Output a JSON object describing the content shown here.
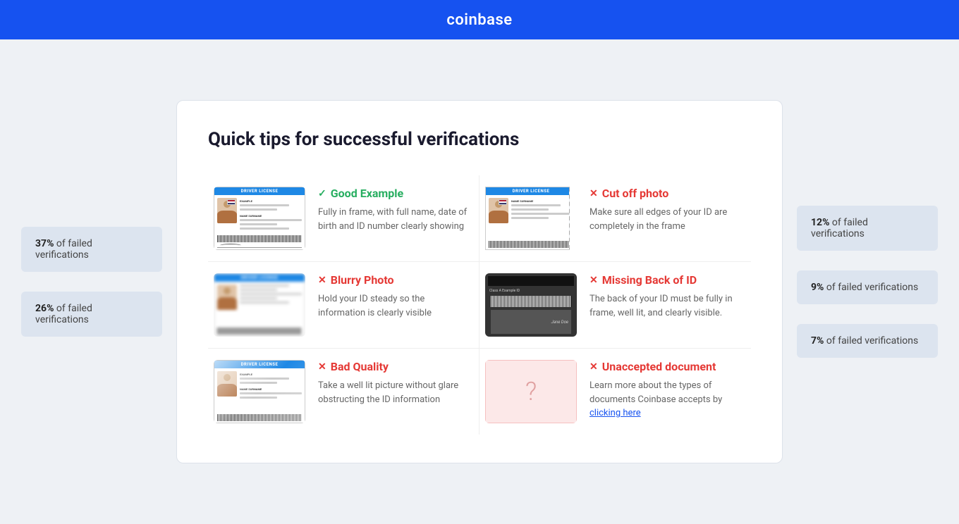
{
  "header": {
    "logo": "coinbase"
  },
  "page": {
    "title": "Quick tips for successful verifications"
  },
  "left_stats": [
    {
      "percent": "37%",
      "label": "of failed verifications"
    },
    {
      "percent": "26%",
      "label": "of failed verifications"
    }
  ],
  "right_stats": [
    {
      "percent": "12%",
      "label": "of failed verifications"
    },
    {
      "percent": "9%",
      "label": "of failed verifications"
    },
    {
      "percent": "7%",
      "label": "of failed verifications"
    }
  ],
  "examples": [
    {
      "id": "good-example",
      "type": "good",
      "icon": "✓",
      "title": "Good Example",
      "description": "Fully in frame, with full name, date of birth and ID number clearly showing"
    },
    {
      "id": "cut-off",
      "type": "bad",
      "icon": "✕",
      "title": "Cut off photo",
      "description": "Make sure all edges of your ID are completely in the frame"
    },
    {
      "id": "blurry",
      "type": "bad",
      "icon": "✕",
      "title": "Blurry Photo",
      "description": "Hold your ID steady so the information is clearly visible"
    },
    {
      "id": "missing-back",
      "type": "bad",
      "icon": "✕",
      "title": "Missing Back of ID",
      "description": "The back of your ID must be fully in frame, well lit, and clearly visible."
    },
    {
      "id": "bad-quality",
      "type": "bad",
      "icon": "✕",
      "title": "Bad Quality",
      "description": "Take a well lit picture without glare obstructing the ID information"
    },
    {
      "id": "unaccepted",
      "type": "bad",
      "icon": "✕",
      "title": "Unaccepted document",
      "description": "Learn more about the types of documents Coinbase accepts by",
      "link_text": "clicking here",
      "has_link": true
    }
  ]
}
